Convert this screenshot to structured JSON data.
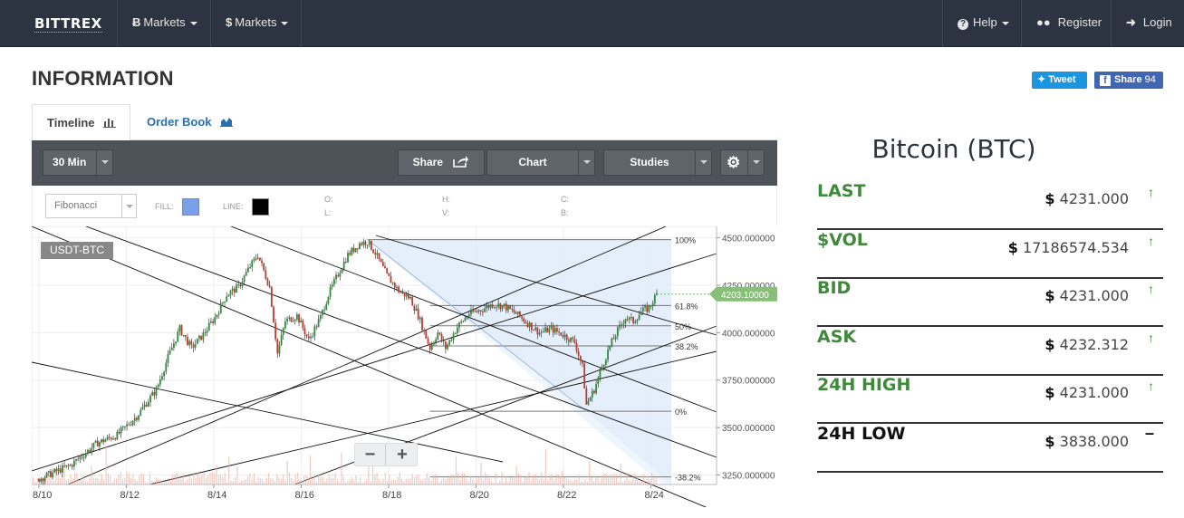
{
  "nav": {
    "brand": "BITTREX",
    "markets_btc": "Markets",
    "markets_usd": "Markets",
    "help": "Help",
    "register": "Register",
    "login": "Login"
  },
  "page": {
    "title": "INFORMATION",
    "tweet": "Tweet",
    "share_label": "Share",
    "share_count": "94"
  },
  "tabs": [
    {
      "label": "Timeline"
    },
    {
      "label": "Order Book"
    }
  ],
  "toolbar": {
    "interval": "30 Min",
    "share": "Share",
    "chart": "Chart",
    "studies": "Studies"
  },
  "subtoolbar": {
    "drawing_tool": "Fibonacci",
    "fill_label": "FILL:",
    "line_label": "LINE:",
    "fill_color": "#7a9fe8",
    "line_color": "#000000",
    "ohlc": [
      "O:",
      "L:",
      "H:",
      "V:",
      "C:",
      "B:"
    ]
  },
  "chart_data": {
    "type": "candlestick",
    "symbol": "USDT-BTC",
    "x_ticks": [
      "8/10",
      "8/12",
      "8/14",
      "8/16",
      "8/18",
      "8/20",
      "8/22",
      "8/24"
    ],
    "y_ticks": [
      "4500.000000",
      "4250.000000",
      "4000.000000",
      "3750.000000",
      "3500.000000",
      "3250.000000"
    ],
    "ylim": [
      3200,
      4560
    ],
    "last_price_label": "4203.10000",
    "last_price": 4203.1,
    "fib_levels": [
      {
        "label": "100%",
        "price": 4490
      },
      {
        "label": "61.8%",
        "price": 4143
      },
      {
        "label": "50%",
        "price": 4036
      },
      {
        "label": "38.2%",
        "price": 3930
      },
      {
        "label": "0%",
        "price": 3586
      },
      {
        "label": "-38.2%",
        "price": 3240
      }
    ],
    "price_path": [
      [
        0,
        3230
      ],
      [
        8,
        3300
      ],
      [
        15,
        3420
      ],
      [
        20,
        3460
      ],
      [
        25,
        3560
      ],
      [
        30,
        3700
      ],
      [
        33,
        3870
      ],
      [
        36,
        4020
      ],
      [
        39,
        3920
      ],
      [
        42,
        3990
      ],
      [
        45,
        4080
      ],
      [
        48,
        4200
      ],
      [
        51,
        4240
      ],
      [
        54,
        4350
      ],
      [
        56,
        4410
      ],
      [
        59,
        4240
      ],
      [
        61,
        3890
      ],
      [
        63,
        4060
      ],
      [
        66,
        4090
      ],
      [
        69,
        3960
      ],
      [
        72,
        4080
      ],
      [
        74,
        4200
      ],
      [
        77,
        4330
      ],
      [
        79,
        4410
      ],
      [
        82,
        4470
      ],
      [
        84,
        4480
      ],
      [
        86,
        4420
      ],
      [
        89,
        4300
      ],
      [
        92,
        4220
      ],
      [
        95,
        4180
      ],
      [
        97,
        4090
      ],
      [
        100,
        3920
      ],
      [
        102,
        4000
      ],
      [
        104,
        3920
      ],
      [
        107,
        4030
      ],
      [
        110,
        4100
      ],
      [
        113,
        4120
      ],
      [
        116,
        4150
      ],
      [
        119,
        4140
      ],
      [
        122,
        4100
      ],
      [
        125,
        4050
      ],
      [
        128,
        4000
      ],
      [
        131,
        4020
      ],
      [
        134,
        3990
      ],
      [
        137,
        3950
      ],
      [
        139,
        3820
      ],
      [
        140,
        3620
      ],
      [
        142,
        3700
      ],
      [
        144,
        3820
      ],
      [
        146,
        3930
      ],
      [
        148,
        4010
      ],
      [
        150,
        4080
      ],
      [
        152,
        4060
      ],
      [
        154,
        4110
      ],
      [
        156,
        4130
      ],
      [
        158,
        4203
      ]
    ]
  },
  "coin": {
    "title": "Bitcoin (BTC)",
    "stats": [
      {
        "label": "LAST",
        "currency": "$",
        "value": "4231.000",
        "trend": "up"
      },
      {
        "label": "$VOL",
        "currency": "$",
        "value": "17186574.534",
        "trend": "up"
      },
      {
        "label": "BID",
        "currency": "$",
        "value": "4231.000",
        "trend": "up"
      },
      {
        "label": "ASK",
        "currency": "$",
        "value": "4232.312",
        "trend": "up"
      },
      {
        "label": "24H HIGH",
        "currency": "$",
        "value": "4231.000",
        "trend": "up"
      },
      {
        "label": "24H LOW",
        "currency": "$",
        "value": "3838.000",
        "trend": "flat"
      }
    ]
  }
}
